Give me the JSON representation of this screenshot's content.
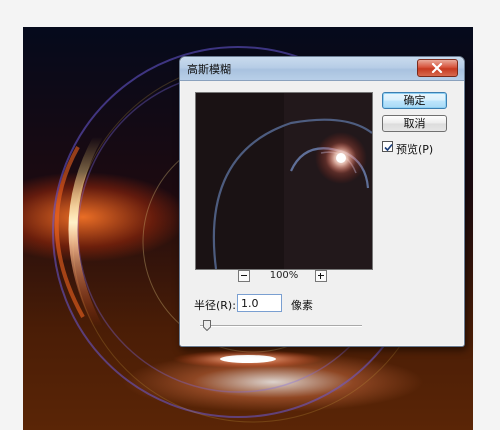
{
  "dialog": {
    "title": "高斯模糊",
    "ok_label": "确定",
    "cancel_label": "取消",
    "preview_label": "预览(P)",
    "preview_checked": true,
    "zoom_level": "100%",
    "radius_label": "半径(R):",
    "radius_value": "1.0",
    "radius_unit": "像素",
    "slider_level": 0.02
  },
  "colors": {
    "titlebar": "#b7cde6",
    "close_button": "#c63a21",
    "ok_border": "#3c7fb1"
  },
  "icons": {
    "close": "close-x-icon",
    "zoom_out": "minus-icon",
    "zoom_in": "plus-icon",
    "checkbox": "checkmark-icon"
  }
}
